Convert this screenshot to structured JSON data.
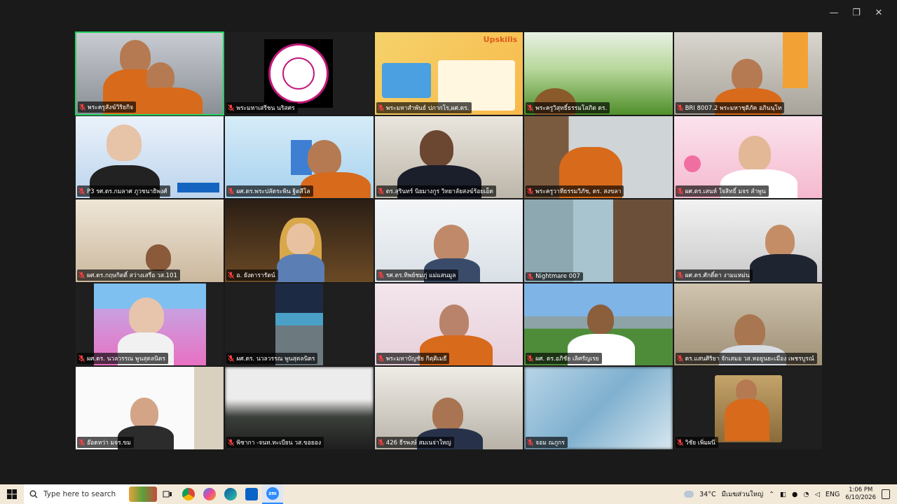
{
  "window": {
    "controls": [
      {
        "name": "minimize-button",
        "glyph": "—"
      },
      {
        "name": "maximize-button",
        "glyph": "❐"
      },
      {
        "name": "close-button",
        "glyph": "✕"
      }
    ]
  },
  "participants": [
    {
      "name": "พระครูสังฆ์วิริยกิจ",
      "scene": "monks-room",
      "active": true
    },
    {
      "name": "พระมหาเสรีชน นริสศร",
      "scene": "logo"
    },
    {
      "name": "พระมหาสำพันธ์ ปภากโร,ผศ.ดร.",
      "scene": "upskills-poster"
    },
    {
      "name": "พระครูวิสุทธิ์ธรรมโสภิต ดร.",
      "scene": "grass"
    },
    {
      "name": "BRI 8007.2 พระมหาชุติภัค อภินนฺโท",
      "scene": "monk-office"
    },
    {
      "name": "P3 รศ.ดร.กมลาศ ภูวชนาธิพงศ์",
      "scene": "lady-poster"
    },
    {
      "name": "ผศ.ดร.พระปลัดระพิน ฐิตสีโล",
      "scene": "monk-poster"
    },
    {
      "name": "ดร.สุรินทร์ นิยมางกูร วิทยาลัยสงฆ์ร้อยเอ็ด",
      "scene": "man-suit"
    },
    {
      "name": "พระครูวาทีธรรมวิภัช, ดร. สงขลา",
      "scene": "monk-shelf"
    },
    {
      "name": "ผศ.ดร.เสนห์ ใจสิทธิ์ มจร ลำพูน",
      "scene": "man-pink"
    },
    {
      "name": "ผศ.ดร.กฤษกิตติ์ สว่างเสรือ วส.101",
      "scene": "man-room"
    },
    {
      "name": "อ. ยังดารารัตน์",
      "scene": "woman-chair"
    },
    {
      "name": "รศ.ดร.ทิพย์ชมภู่ แม่แสนมูล",
      "scene": "woman-poster"
    },
    {
      "name": "Nightmare 007",
      "scene": "curtain-room"
    },
    {
      "name": "ผศ.ดร.ศักดิ์ดา งามแหม่น",
      "scene": "man-office"
    },
    {
      "name": "ผศ.ดร. นวลวรรณ พูนสุดลนิดร",
      "scene": "flower-photo"
    },
    {
      "name": "ผศ.ดร. นวลวรรณ พูนสุดลนิดร",
      "scene": "beach-photo"
    },
    {
      "name": "พระมหาบัญชัย กิตฺติเมธี",
      "scene": "monk-direct"
    },
    {
      "name": "ผศ. ดร.อภิชัย เลิศรัญเรย",
      "scene": "mountain"
    },
    {
      "name": "ดร.แสนศิริยา จักเสมอ วส.หอยูนยะเมือง เพชรบูรณ์",
      "scene": "man-glasses"
    },
    {
      "name": "อ๊อดหว่า มจร.ขม",
      "scene": "man-white"
    },
    {
      "name": "พิชากา -จนท.ทะเบียน วส.ขอยอง",
      "scene": "blur-dark"
    },
    {
      "name": "426 ธีรพงษ์ สมเนจ่าใหญ่",
      "scene": "man-blur"
    },
    {
      "name": "จอม ณภูกร",
      "scene": "blur-blue"
    },
    {
      "name": "วิชัย เพิ่มผนี",
      "scene": "monk-avatar"
    }
  ],
  "taskbar": {
    "search_placeholder": "Type here to search",
    "weather": "34°C",
    "weather_desc": "มีเมฆส่วนใหญ่",
    "language": "ENG",
    "time": "1:06 PM",
    "date": "6/10/2026"
  }
}
